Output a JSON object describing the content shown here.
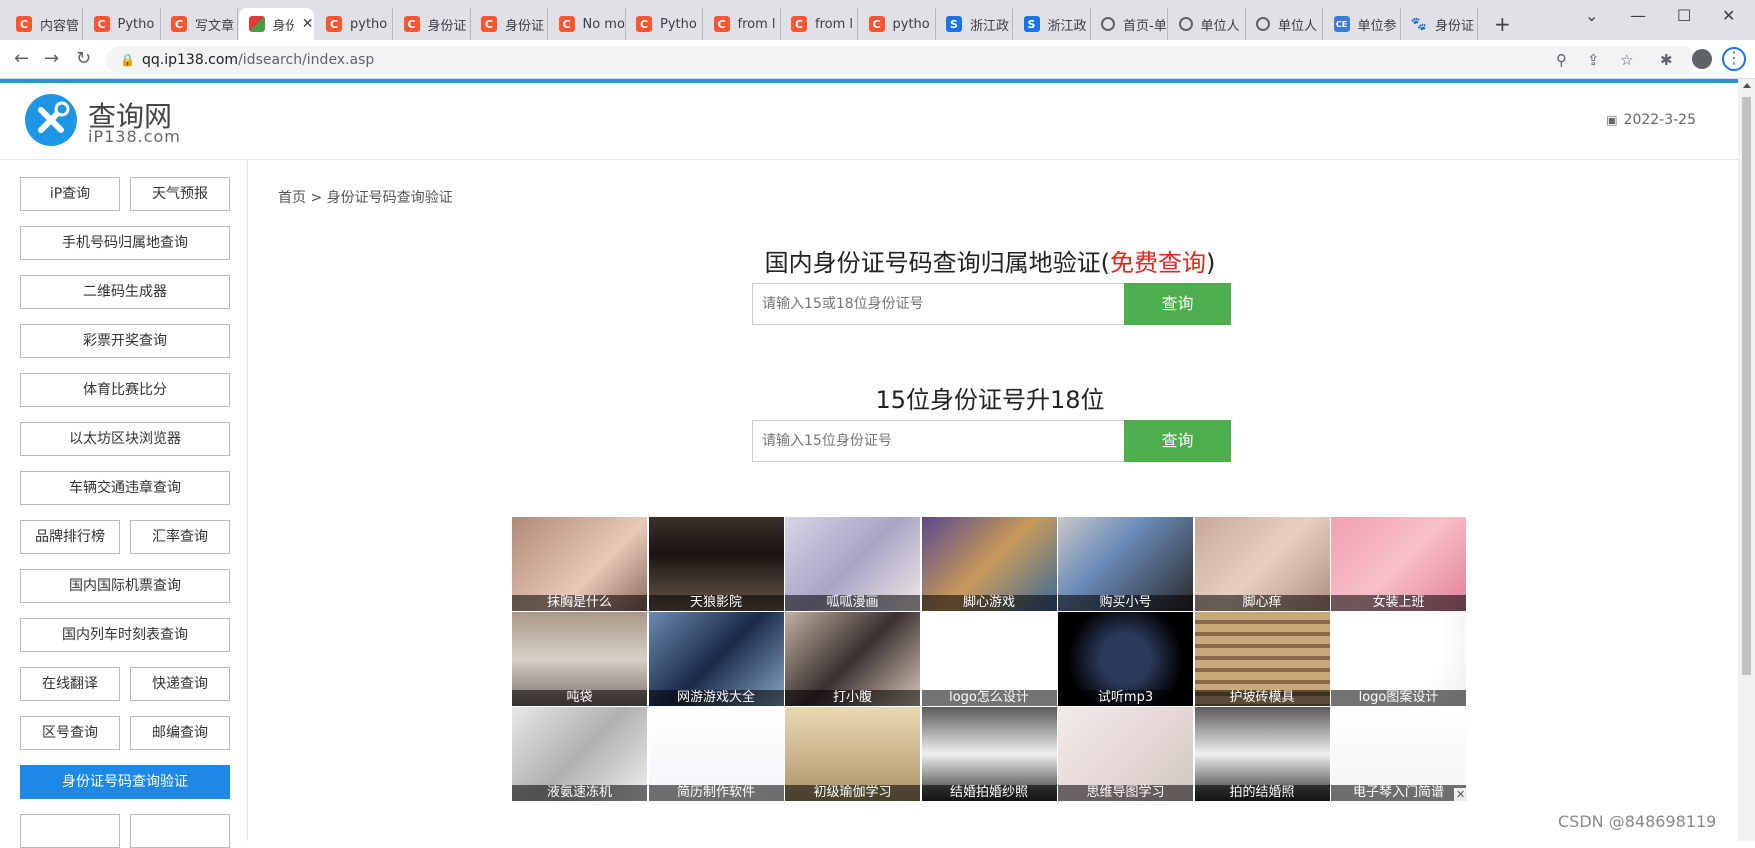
{
  "browser": {
    "tabs": [
      {
        "label": "内容管",
        "icon": "csdn"
      },
      {
        "label": "Pytho",
        "icon": "csdn"
      },
      {
        "label": "写文章",
        "icon": "csdn"
      },
      {
        "label": "身份",
        "icon": "ip138",
        "active": true
      },
      {
        "label": "pytho",
        "icon": "csdn"
      },
      {
        "label": "身份证",
        "icon": "csdn"
      },
      {
        "label": "身份证",
        "icon": "csdn"
      },
      {
        "label": "No mo",
        "icon": "csdn"
      },
      {
        "label": "Pytho",
        "icon": "csdn"
      },
      {
        "label": "from l",
        "icon": "csdn"
      },
      {
        "label": "from l",
        "icon": "csdn"
      },
      {
        "label": "pytho",
        "icon": "csdn"
      },
      {
        "label": "浙江政",
        "icon": "zj"
      },
      {
        "label": "浙江政",
        "icon": "zj"
      },
      {
        "label": "首页-单",
        "icon": "globe"
      },
      {
        "label": "单位人",
        "icon": "globe"
      },
      {
        "label": "单位人",
        "icon": "globe"
      },
      {
        "label": "单位参",
        "icon": "dl"
      },
      {
        "label": "身份证",
        "icon": "baidu"
      }
    ],
    "new_tab": "+",
    "url_host": "qq.ip138.com",
    "url_path": "/idsearch/index.asp"
  },
  "header": {
    "logo_title": "查询网",
    "logo_sub": "iP138.com",
    "date": "2022-3-25"
  },
  "sidebar": {
    "items": [
      "iP查询",
      "天气预报",
      "手机号码归属地查询",
      "二维码生成器",
      "彩票开奖查询",
      "体育比赛比分",
      "以太坊区块浏览器",
      "车辆交通违章查询",
      "品牌排行榜",
      "汇率查询",
      "国内国际机票查询",
      "国内列车时刻表查询",
      "在线翻译",
      "快递查询",
      "区号查询",
      "邮编查询",
      "身份证号码查询验证"
    ]
  },
  "main": {
    "breadcrumb": "首页 > 身份证号码查询验证",
    "section1_title": "国内身份证号码查询归属地验证(",
    "section1_red": "免费查询",
    "section1_close": ")",
    "input1_placeholder": "请输入15或18位身份证号",
    "btn_label": "查询",
    "section2_title": "15位身份证号升18位",
    "input2_placeholder": "请输入15位身份证号"
  },
  "ads": {
    "captions": [
      "抹胸是什么",
      "天狼影院",
      "呱呱漫画",
      "脚心游戏",
      "购买小号",
      "脚心痒",
      "女装上班",
      "吨袋",
      "网游游戏大全",
      "打小腹",
      "logo怎么设计",
      "试听mp3",
      "护坡砖模具",
      "logo图案设计",
      "液氨速冻机",
      "简历制作软件",
      "初级瑜伽学习",
      "结婚拍婚纱照",
      "思维导图学习",
      "拍的结婚照",
      "电子琴入门简谱"
    ],
    "close": "✕"
  },
  "watermark": "CSDN @848698119"
}
